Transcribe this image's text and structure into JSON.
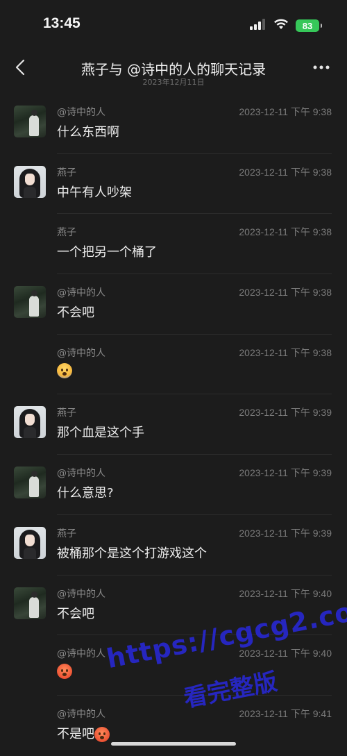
{
  "status_bar": {
    "time": "13:45",
    "battery": "83"
  },
  "nav": {
    "title": "燕子与 @诗中的人的聊天记录",
    "subtitle": "2023年12月11日",
    "back_icon": "chevron-left-icon",
    "more_icon": "more-dots-icon"
  },
  "messages": [
    {
      "sender": "@诗中的人",
      "time": "2023-12-11 下午 9:38",
      "text": "什么东西啊",
      "avatar": "poet",
      "show_avatar": true
    },
    {
      "sender": "燕子",
      "time": "2023-12-11 下午 9:38",
      "text": "中午有人吵架",
      "avatar": "yanzi",
      "show_avatar": true
    },
    {
      "sender": "燕子",
      "time": "2023-12-11 下午 9:38",
      "text": "一个把另一个桶了",
      "avatar": "yanzi",
      "show_avatar": false
    },
    {
      "sender": "@诗中的人",
      "time": "2023-12-11 下午 9:38",
      "text": "不会吧",
      "avatar": "poet",
      "show_avatar": true
    },
    {
      "sender": "@诗中的人",
      "time": "2023-12-11 下午 9:38",
      "text": "",
      "emoji": "scream-face-emoji",
      "avatar": "poet",
      "show_avatar": false
    },
    {
      "sender": "燕子",
      "time": "2023-12-11 下午 9:39",
      "text": "那个血是这个手",
      "avatar": "yanzi",
      "show_avatar": true
    },
    {
      "sender": "@诗中的人",
      "time": "2023-12-11 下午 9:39",
      "text": "什么意思?",
      "avatar": "poet",
      "show_avatar": true
    },
    {
      "sender": "燕子",
      "time": "2023-12-11 下午 9:39",
      "text": "被桶那个是这个打游戏这个",
      "avatar": "yanzi",
      "show_avatar": true
    },
    {
      "sender": "@诗中的人",
      "time": "2023-12-11 下午 9:40",
      "text": "不会吧",
      "avatar": "poet",
      "show_avatar": true
    },
    {
      "sender": "@诗中的人",
      "time": "2023-12-11 下午 9:40",
      "text": "",
      "emoji": "angry-face-emoji",
      "avatar": "poet",
      "show_avatar": false
    },
    {
      "sender": "@诗中的人",
      "time": "2023-12-11 下午 9:41",
      "text": "不是吧",
      "emoji": "angry-face-emoji",
      "avatar": "poet",
      "show_avatar": false
    }
  ],
  "watermark": {
    "url": "https://cgcg2.co",
    "text": "看完整版"
  },
  "colors": {
    "background": "#1c1c1c",
    "battery": "#36c759",
    "watermark": "#2828dc"
  }
}
